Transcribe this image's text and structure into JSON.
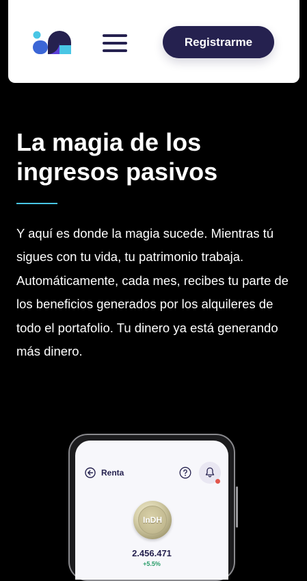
{
  "header": {
    "logo": "indh-logo",
    "menu_icon": "hamburger-menu-icon",
    "register_label": "Registrarme"
  },
  "hero": {
    "title": "La magia de los ingresos pasivos",
    "body": "Y aquí es donde la magia sucede. Mientras tú sigues con tu vida, tu patrimonio trabaja. Automáticamente, cada mes, recibes tu parte de los beneficios generados por los alquileres de todo el portafolio. Tu dinero ya está generando más dinero."
  },
  "phone_screen": {
    "back_icon": "arrow-left-circle-icon",
    "title": "Renta",
    "help_icon": "question-circle-icon",
    "bell_icon": "bell-icon",
    "coin_label": "InDH",
    "amount": "2.456.471",
    "change": "+5.5%"
  },
  "colors": {
    "brand_dark": "#25214f",
    "accent_cyan": "#49c6e5",
    "positive_green": "#2a9d6a",
    "notification_red": "#e2574c"
  }
}
